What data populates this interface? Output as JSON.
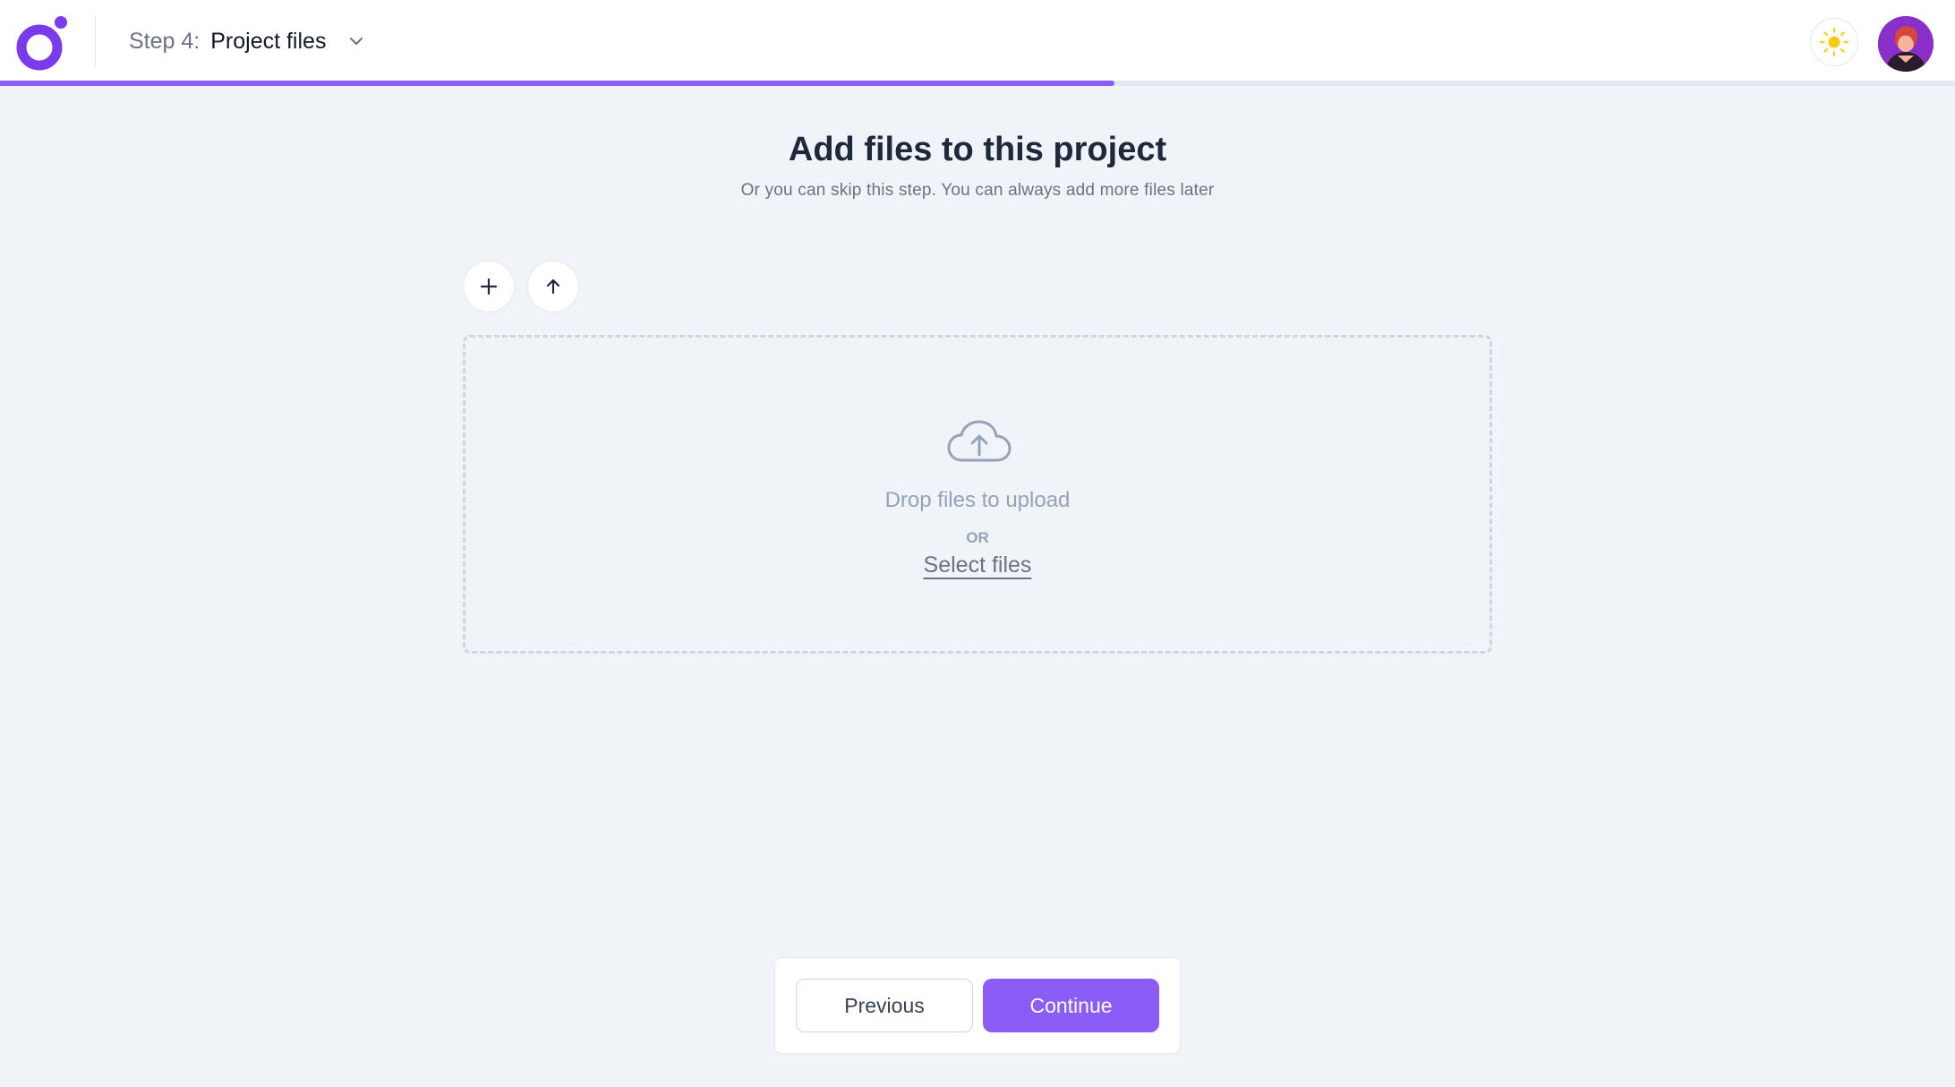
{
  "header": {
    "step_prefix": "Step 4:",
    "step_title": "Project files",
    "progress": 0.57,
    "colors": {
      "accent": "#8b5cf6",
      "sun": "#facc15"
    }
  },
  "main": {
    "title": "Add files to this project",
    "subtitle": "Or you can skip this step. You can always add more files later",
    "toolbar": {
      "add_icon": "plus-icon",
      "upload_icon": "arrow-up-icon"
    },
    "dropzone": {
      "icon": "cloud-upload-icon",
      "drop_text": "Drop files to upload",
      "or_text": "OR",
      "select_label": "Select files"
    }
  },
  "footer": {
    "previous_label": "Previous",
    "continue_label": "Continue"
  }
}
